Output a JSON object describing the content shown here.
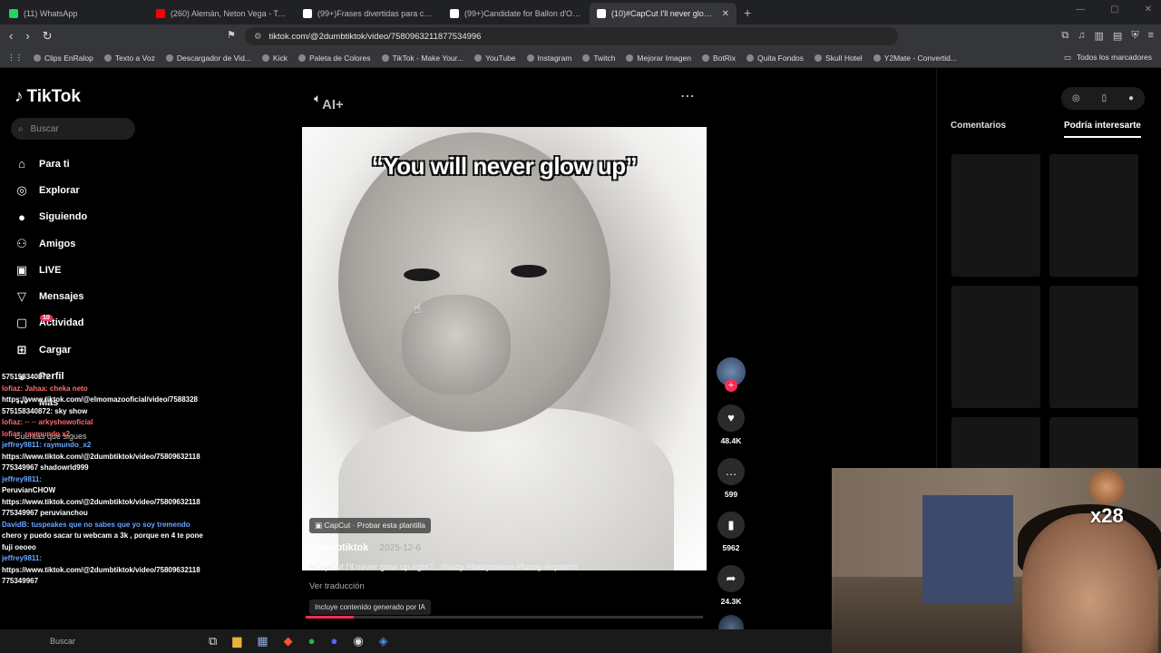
{
  "browser": {
    "tabs": [
      {
        "title": "(11) WhatsApp",
        "color": "#25d366",
        "active": false
      },
      {
        "title": "(260) Alemán, Neton Vega - Te Q",
        "color": "#ff0000",
        "active": false
      },
      {
        "title": "(99+)Frases divertidas para compartir",
        "color": "#ffffff",
        "active": false
      },
      {
        "title": "(99+)Candidate for Ballon d'Or 2025",
        "color": "#ffffff",
        "active": false
      },
      {
        "title": "(10)#CapCut I'll never glow up",
        "color": "#ffffff",
        "active": true
      }
    ],
    "new_tab": "+",
    "url": "tiktok.com/@2dumbtiktok/video/7580963211877534996",
    "bookmarks": [
      "Clips EnRalop",
      "Texto a Voz",
      "Descargador de Vid...",
      "Kick",
      "Paleta de Colores",
      "TikTok - Make Your...",
      "YouTube",
      "Instagram",
      "Twitch",
      "Mejorar Imagen",
      "BotRix",
      "Quita Fondos",
      "Skull Hotel",
      "Y2Mate - Convertid..."
    ],
    "all_bookmarks": "Todos los marcadores"
  },
  "tiktok": {
    "logo": "TikTok",
    "search_placeholder": "Buscar",
    "menu": [
      {
        "label": "Para ti",
        "icon": "home-icon",
        "glyph": "⌂"
      },
      {
        "label": "Explorar",
        "icon": "compass-icon",
        "glyph": "◎"
      },
      {
        "label": "Siguiendo",
        "icon": "following-avatar-icon",
        "glyph": "●"
      },
      {
        "label": "Amigos",
        "icon": "friends-icon",
        "glyph": "⚇"
      },
      {
        "label": "LIVE",
        "icon": "live-icon",
        "glyph": "▣"
      },
      {
        "label": "Mensajes",
        "icon": "messages-icon",
        "glyph": "▽"
      },
      {
        "label": "Actividad",
        "icon": "activity-icon",
        "glyph": "▢"
      },
      {
        "label": "Cargar",
        "icon": "upload-icon",
        "glyph": "⊞"
      },
      {
        "label": "Perfil",
        "icon": "profile-icon",
        "glyph": "●"
      },
      {
        "label": "Más",
        "icon": "more-icon",
        "glyph": "⋯"
      }
    ],
    "activity_badge": "10",
    "following_heading": "Cuentas que sigues",
    "video": {
      "caption": "“You will never glow up”",
      "ai_label": "AI+",
      "capcut_label": "CapCut · Probar esta plantilla",
      "author": "2dumbtiktok",
      "date": "· 2025-12-6",
      "description": "#CapCut I'll never glow up right?.. #baby #babymeme #funny #epstein",
      "translate": "Ver traducción",
      "ai_badge": "Incluye contenido generado por IA",
      "progress": 0.12
    },
    "actions": {
      "likes": "48.4K",
      "comments": "599",
      "saves": "5962",
      "shares": "24.3K"
    },
    "right_panel": {
      "tab_comments": "Comentarios",
      "tab_suggested": "Podría interesarte"
    }
  },
  "chat_overlay": [
    {
      "text": "575158340872",
      "cls": ""
    },
    {
      "text": "lofiaz: Jahaa: cheka neto",
      "cls": "r"
    },
    {
      "text": "https://www.tiktok.com/@elmomazooficial/video/7588328",
      "cls": ""
    },
    {
      "text": "575158340872: sky show",
      "cls": ""
    },
    {
      "text": "lofiaz: ·· ·· arkyshowoficial",
      "cls": "r"
    },
    {
      "text": "lofiaz: raymundo x2",
      "cls": "r"
    },
    {
      "text": "jeffrey9811: raymundo_x2",
      "cls": "u"
    },
    {
      "text": "https://www.tiktok.com/@2dumbtiktok/video/75809632118",
      "cls": ""
    },
    {
      "text": "775349967 shadowrld999",
      "cls": ""
    },
    {
      "text": "jeffrey9811:",
      "cls": "u"
    },
    {
      "text": "PeruvianCHOW",
      "cls": ""
    },
    {
      "text": "https://www.tiktok.com/@2dumbtiktok/video/75809632118",
      "cls": ""
    },
    {
      "text": "775349967 peruvianchou",
      "cls": ""
    },
    {
      "text": "DavidB: tuspeakes que no sabes que yo soy tremendo",
      "cls": "u"
    },
    {
      "text": "chero y puedo sacar tu webcam a 3k , porque en 4 te pone",
      "cls": ""
    },
    {
      "text": "fuji oeoeo",
      "cls": ""
    },
    {
      "text": "jeffrey9811:",
      "cls": "u"
    },
    {
      "text": "https://www.tiktok.com/@2dumbtiktok/video/75809632118",
      "cls": ""
    },
    {
      "text": "775349967",
      "cls": ""
    }
  ],
  "webcam": {
    "multiplier": "x28"
  },
  "taskbar": {
    "search": "Buscar"
  }
}
